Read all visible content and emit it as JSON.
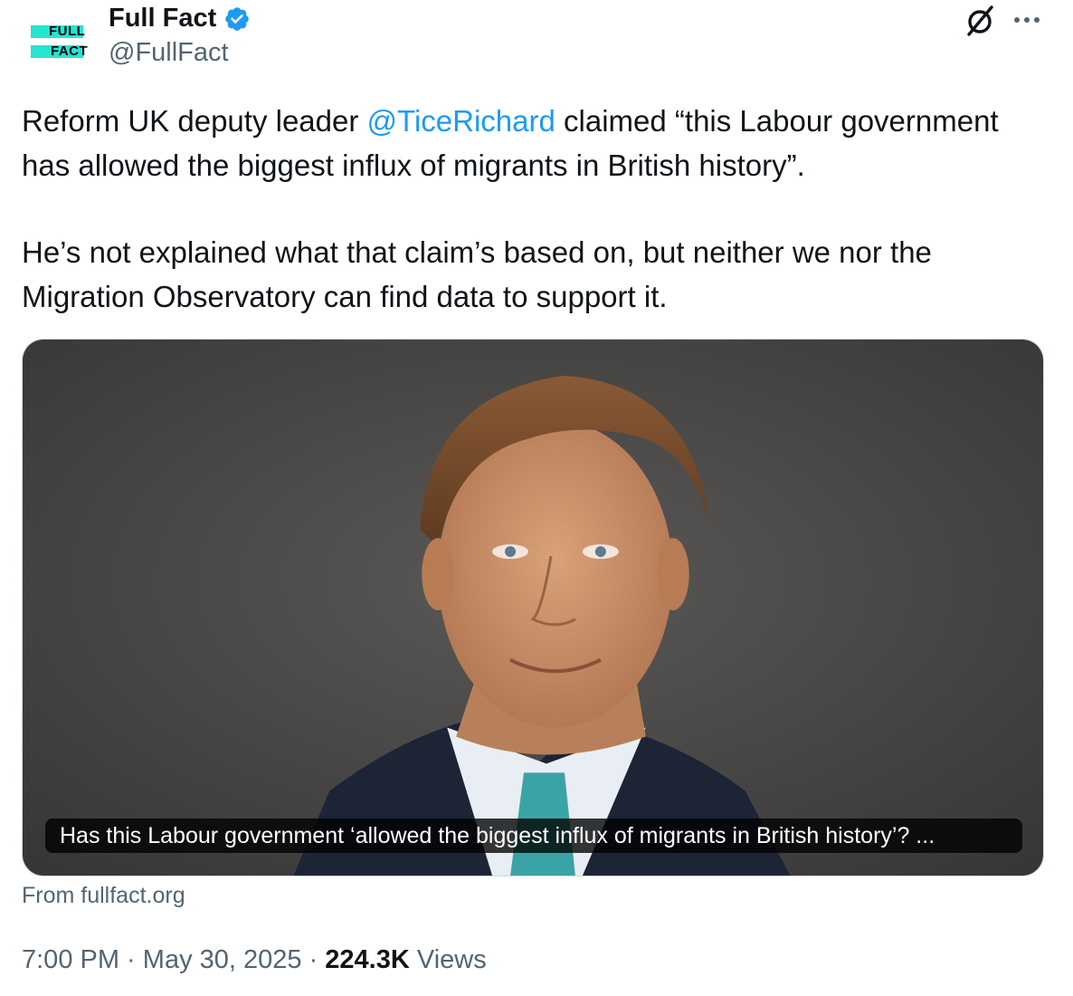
{
  "author": {
    "avatar_text_top": "FULL",
    "avatar_text_bottom": "FACT",
    "display_name": "Full Fact",
    "handle": "@FullFact",
    "verified_icon": "verified-badge-icon",
    "accent_color": "#23e5d2"
  },
  "header_actions": {
    "grok_icon": "grok-icon",
    "more_icon": "more-dots-icon"
  },
  "tweet": {
    "para1_before": "Reform UK deputy leader ",
    "mention": "@TiceRichard",
    "para1_after": " claimed “this Labour government has allowed the biggest influx of migrants in British history”.",
    "para2": "He’s not explained what that claim’s based on, but neither we nor the Migration Observatory can find data to support it."
  },
  "media": {
    "caption": "Has this Labour government ‘allowed the biggest influx of migrants in British history’? ...",
    "source": "From fullfact.org"
  },
  "meta": {
    "time": "7:00 PM",
    "separator": " · ",
    "date": "May 30, 2025",
    "views_count": "224.3K",
    "views_label": " Views"
  },
  "colors": {
    "link": "#1d9bf0",
    "secondary_text": "#536471",
    "primary_text": "#0f1419"
  }
}
